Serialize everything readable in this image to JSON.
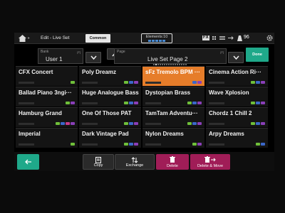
{
  "header": {
    "breadcrumb_icon": "home-icon",
    "title": "Edit - Live Set",
    "tab": "Common",
    "elements_label": "Elements:10",
    "fx_label": "FX",
    "tempo_label": "96"
  },
  "bank": {
    "label": "Bank",
    "value": "User 1",
    "ctrl": "[F]"
  },
  "page": {
    "label": "Page",
    "value": "Live Set Page 2",
    "ctrl": "[F]"
  },
  "done_label": "Done",
  "slots": [
    {
      "name": "CFX Concert",
      "tags": [
        "green"
      ]
    },
    {
      "name": "Poly Dreamz",
      "tags": [
        "green",
        "blue",
        "purple"
      ]
    },
    {
      "name": "sFz Tremolo BPM ···",
      "tags": [
        "blue",
        "purple"
      ],
      "selected": true
    },
    {
      "name": "Cinema Action Ri···",
      "tags": [
        "green",
        "blue",
        "purple"
      ]
    },
    {
      "name": "Ballad Piano 3ngi···",
      "tags": [
        "green",
        "purple"
      ]
    },
    {
      "name": "Huge Analogue Bass",
      "tags": [
        "green",
        "blue",
        "purple"
      ]
    },
    {
      "name": "Dystopian Brass",
      "tags": [
        "green",
        "blue",
        "purple"
      ]
    },
    {
      "name": "Wave Xplosion",
      "tags": [
        "green",
        "blue",
        "purple"
      ]
    },
    {
      "name": "Hamburg Grand",
      "tags": [
        "green",
        "blue",
        "pink",
        "purple"
      ]
    },
    {
      "name": "One Of Those PAT",
      "tags": [
        "green",
        "blue",
        "purple"
      ]
    },
    {
      "name": "TamTam Adventu···",
      "tags": [
        "green",
        "blue",
        "purple"
      ]
    },
    {
      "name": "Chordz 1 Chill 2",
      "tags": [
        "green",
        "blue",
        "purple"
      ]
    },
    {
      "name": "Imperial",
      "tags": [
        "green"
      ]
    },
    {
      "name": "Dark Vintage Pad",
      "tags": [
        "green",
        "blue",
        "purple"
      ]
    },
    {
      "name": "Nylon Dreams",
      "tags": [
        "green",
        "purple"
      ]
    },
    {
      "name": "Arpy Dreams",
      "tags": [
        "green",
        "blue"
      ]
    }
  ],
  "bottom": {
    "copy": "Copy",
    "exchange": "Exchange",
    "delete": "Delete",
    "delete_move": "Delete & Move"
  },
  "colors": {
    "accent": "#1fa98a",
    "selected": "#e67d2a",
    "delete": "#a01d57"
  }
}
